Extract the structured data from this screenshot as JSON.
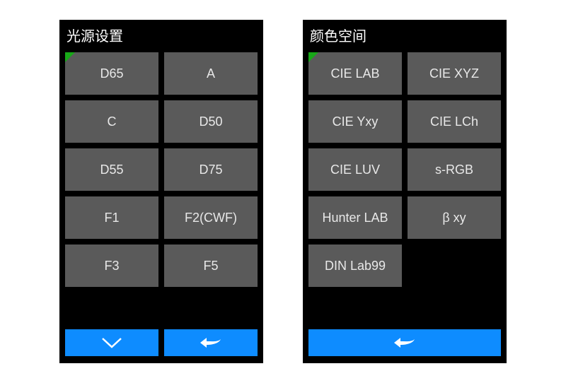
{
  "panels": [
    {
      "title": "光源设置",
      "items": [
        "D65",
        "A",
        "C",
        "D50",
        "D55",
        "D75",
        "F1",
        "F2(CWF)",
        "F3",
        "F5"
      ],
      "footer": [
        "down",
        "back"
      ]
    },
    {
      "title": "颜色空间",
      "items": [
        "CIE LAB",
        "CIE XYZ",
        "CIE Yxy",
        "CIE LCh",
        "CIE LUV",
        "s-RGB",
        "Hunter LAB",
        "β xy",
        "DIN Lab99"
      ],
      "footer": [
        "back"
      ]
    }
  ],
  "colors": {
    "accent": "#0e8cff",
    "cell": "#5a5a5a",
    "corner": "#18a818"
  },
  "icons": {
    "down": "chevron-down-icon",
    "back": "back-arrow-icon"
  }
}
